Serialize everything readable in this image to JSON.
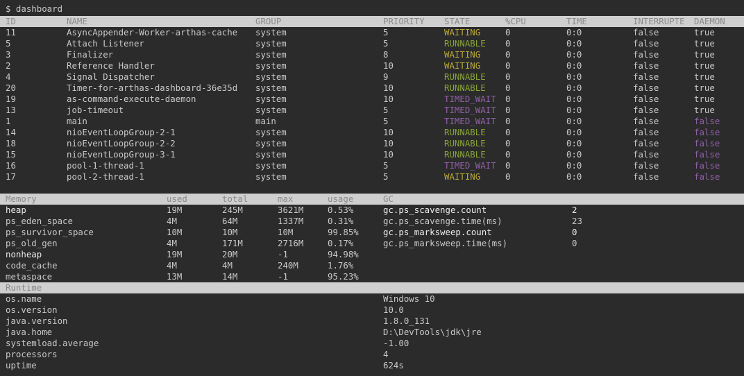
{
  "prompt": "$ dashboard",
  "threads": {
    "headers": [
      "ID",
      "NAME",
      "GROUP",
      "PRIORITY",
      "STATE",
      "%CPU",
      "TIME",
      "INTERRUPTE",
      "DAEMON"
    ],
    "rows": [
      {
        "id": "11",
        "name": "AsyncAppender-Worker-arthas-cache",
        "group": "system",
        "priority": "5",
        "state": "WAITING",
        "cpu": "0",
        "time": "0:0",
        "interrupted": "false",
        "daemon": "true"
      },
      {
        "id": "5",
        "name": "Attach Listener",
        "group": "system",
        "priority": "5",
        "state": "RUNNABLE",
        "cpu": "0",
        "time": "0:0",
        "interrupted": "false",
        "daemon": "true"
      },
      {
        "id": "3",
        "name": "Finalizer",
        "group": "system",
        "priority": "8",
        "state": "WAITING",
        "cpu": "0",
        "time": "0:0",
        "interrupted": "false",
        "daemon": "true"
      },
      {
        "id": "2",
        "name": "Reference Handler",
        "group": "system",
        "priority": "10",
        "state": "WAITING",
        "cpu": "0",
        "time": "0:0",
        "interrupted": "false",
        "daemon": "true"
      },
      {
        "id": "4",
        "name": "Signal Dispatcher",
        "group": "system",
        "priority": "9",
        "state": "RUNNABLE",
        "cpu": "0",
        "time": "0:0",
        "interrupted": "false",
        "daemon": "true"
      },
      {
        "id": "20",
        "name": "Timer-for-arthas-dashboard-36e35d",
        "group": "system",
        "priority": "10",
        "state": "RUNNABLE",
        "cpu": "0",
        "time": "0:0",
        "interrupted": "false",
        "daemon": "true"
      },
      {
        "id": "19",
        "name": "as-command-execute-daemon",
        "group": "system",
        "priority": "10",
        "state": "TIMED_WAIT",
        "cpu": "0",
        "time": "0:0",
        "interrupted": "false",
        "daemon": "true"
      },
      {
        "id": "13",
        "name": "job-timeout",
        "group": "system",
        "priority": "5",
        "state": "TIMED_WAIT",
        "cpu": "0",
        "time": "0:0",
        "interrupted": "false",
        "daemon": "true"
      },
      {
        "id": "1",
        "name": "main",
        "group": "main",
        "priority": "5",
        "state": "TIMED_WAIT",
        "cpu": "0",
        "time": "0:0",
        "interrupted": "false",
        "daemon": "false"
      },
      {
        "id": "14",
        "name": "nioEventLoopGroup-2-1",
        "group": "system",
        "priority": "10",
        "state": "RUNNABLE",
        "cpu": "0",
        "time": "0:0",
        "interrupted": "false",
        "daemon": "false"
      },
      {
        "id": "18",
        "name": "nioEventLoopGroup-2-2",
        "group": "system",
        "priority": "10",
        "state": "RUNNABLE",
        "cpu": "0",
        "time": "0:0",
        "interrupted": "false",
        "daemon": "false"
      },
      {
        "id": "15",
        "name": "nioEventLoopGroup-3-1",
        "group": "system",
        "priority": "10",
        "state": "RUNNABLE",
        "cpu": "0",
        "time": "0:0",
        "interrupted": "false",
        "daemon": "false"
      },
      {
        "id": "16",
        "name": "pool-1-thread-1",
        "group": "system",
        "priority": "5",
        "state": "TIMED_WAIT",
        "cpu": "0",
        "time": "0:0",
        "interrupted": "false",
        "daemon": "false"
      },
      {
        "id": "17",
        "name": "pool-2-thread-1",
        "group": "system",
        "priority": "5",
        "state": "WAITING",
        "cpu": "0",
        "time": "0:0",
        "interrupted": "false",
        "daemon": "false"
      }
    ]
  },
  "memory": {
    "headers": [
      "Memory",
      "used",
      "total",
      "max",
      "usage",
      "GC"
    ],
    "rows": [
      {
        "name": "heap",
        "used": "19M",
        "total": "245M",
        "max": "3621M",
        "usage": "0.53%",
        "bold": true
      },
      {
        "name": "ps_eden_space",
        "used": "4M",
        "total": "64M",
        "max": "1337M",
        "usage": "0.31%",
        "bold": false
      },
      {
        "name": "ps_survivor_space",
        "used": "10M",
        "total": "10M",
        "max": "10M",
        "usage": "99.85%",
        "bold": false
      },
      {
        "name": "ps_old_gen",
        "used": "4M",
        "total": "171M",
        "max": "2716M",
        "usage": "0.17%",
        "bold": false
      },
      {
        "name": "nonheap",
        "used": "19M",
        "total": "20M",
        "max": "-1",
        "usage": "94.98%",
        "bold": true
      },
      {
        "name": "code_cache",
        "used": "4M",
        "total": "4M",
        "max": "240M",
        "usage": "1.76%",
        "bold": false
      },
      {
        "name": "metaspace",
        "used": "13M",
        "total": "14M",
        "max": "-1",
        "usage": "95.23%",
        "bold": false
      }
    ],
    "gc": [
      {
        "name": "gc.ps_scavenge.count",
        "value": "2",
        "bold": true
      },
      {
        "name": "gc.ps_scavenge.time(ms)",
        "value": "23",
        "bold": false
      },
      {
        "name": "gc.ps_marksweep.count",
        "value": "0",
        "bold": true
      },
      {
        "name": "gc.ps_marksweep.time(ms)",
        "value": "0",
        "bold": false
      }
    ]
  },
  "runtime": {
    "header": "Runtime",
    "rows": [
      {
        "key": "os.name",
        "value": "Windows 10"
      },
      {
        "key": "os.version",
        "value": "10.0"
      },
      {
        "key": "java.version",
        "value": "1.8.0_131"
      },
      {
        "key": "java.home",
        "value": "D:\\DevTools\\jdk\\jre"
      },
      {
        "key": "systemload.average",
        "value": "-1.00"
      },
      {
        "key": "processors",
        "value": "4"
      },
      {
        "key": "uptime",
        "value": "624s"
      }
    ]
  },
  "colors": {
    "background": "#2b2b2b",
    "header_bar": "#cfcfcf",
    "runnable": "#8aa536",
    "waiting": "#b9a83a",
    "timed_wait": "#8f60a8",
    "daemon_false": "#8f60a8"
  }
}
